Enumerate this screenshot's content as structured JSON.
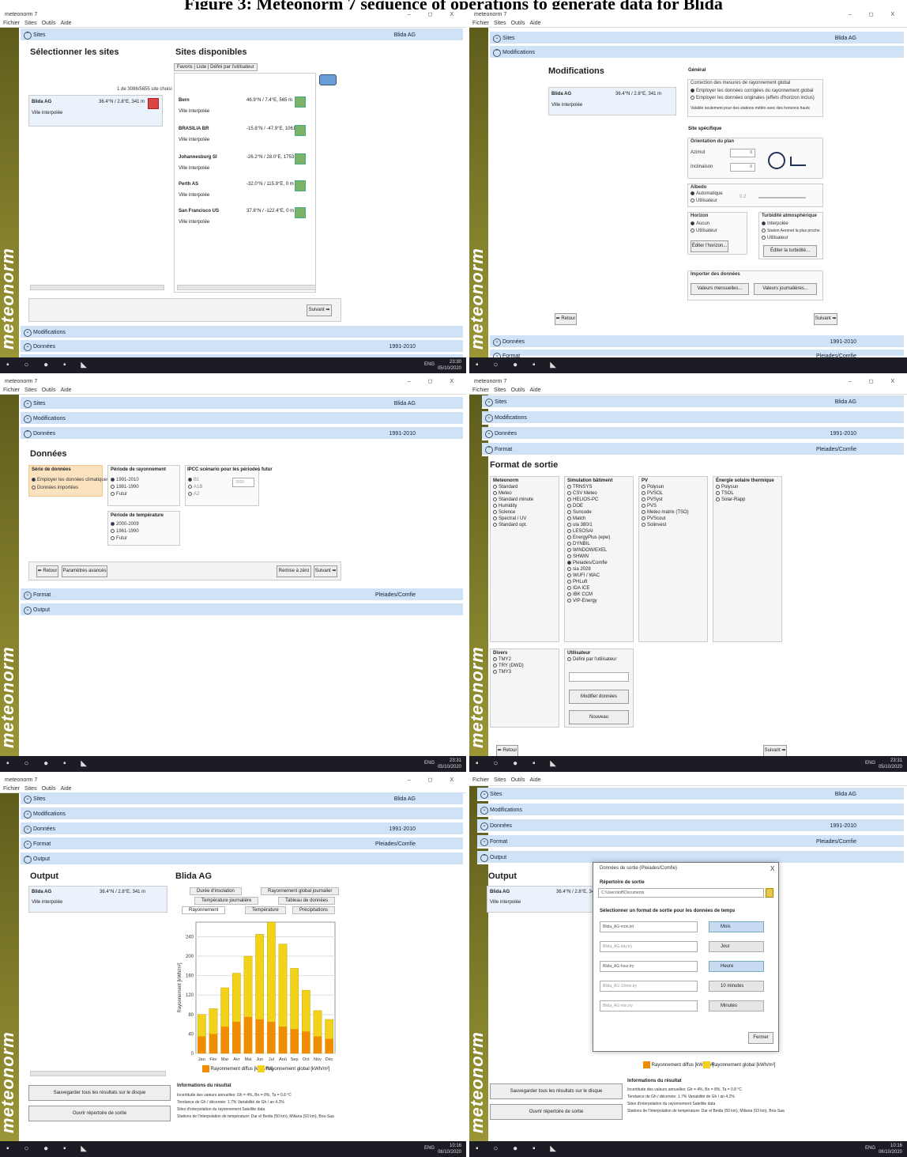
{
  "heading": "Figure 3: Meteonorm 7 sequence of operations to generate data for Blida",
  "app": {
    "title": "meteonorm 7",
    "menu": [
      "Fichier",
      "Sites",
      "Outils",
      "Aide"
    ],
    "brand": "meteonorm",
    "window_controls": "–  ◻  X"
  },
  "sections": {
    "sites": "Sites",
    "modifications": "Modifications",
    "donnees": "Données",
    "format": "Format",
    "output": "Output",
    "site_value": "Blida AG",
    "period_value": "1991-2010",
    "format_value": "Pleiades/Comfie"
  },
  "taskbar": {
    "clock1": "23:30",
    "date1": "05/10/2020",
    "clock2": "23:31",
    "date2": "05/10/2020",
    "clock3": "10:16",
    "date3": "06/10/2020",
    "lang": "ENG"
  },
  "p1": {
    "title_left": "Sélectionner les sites",
    "title_right": "Sites disponibles",
    "tabs": [
      "Favoris",
      "Liste",
      "Défini par l'utilisateur"
    ],
    "count": "1 de 3086/5655 site choisi",
    "selected_site": "Blida AG",
    "selected_coords": "36.4°N / 2.8°E, 341 m",
    "selected_sub": "Ville interpolée",
    "sites": [
      {
        "name": "Bern",
        "coords": "46.9°N / 7.4°E, 565 m",
        "sub": "Ville interpolée"
      },
      {
        "name": "BRASILIA BR",
        "coords": "-15.8°N / -47.9°E, 1061 m",
        "sub": "Ville interpolée"
      },
      {
        "name": "Johannesburg SI",
        "coords": "-26.2°N / 28.0°E, 1753 m",
        "sub": "Ville interpolée"
      },
      {
        "name": "Perth AS",
        "coords": "-32.0°N / 115.9°E, 0 m",
        "sub": "Ville interpolée"
      },
      {
        "name": "San Francisco US",
        "coords": "37.8°N / -122.4°E, 0 m",
        "sub": "Ville interpolée"
      }
    ],
    "next": "Suivant ➡"
  },
  "p2": {
    "title": "Modifications",
    "site": "Blida AG",
    "coords": "36.4°N / 2.8°E, 341 m",
    "sub": "Ville interpolée",
    "general": "Général",
    "corr_title": "Correction des mesures de rayonnement global",
    "corr1": "Employer les données corrigées du rayonnement global",
    "corr2": "Employer les données originales (effets d'horizon inclus)",
    "corr_note": "Valable seulement pour des stations météo avec des horizons hauts",
    "specific": "Site spécifique",
    "orientation": "Orientation du plan",
    "azimut": "Azimut",
    "azimut_val": "0",
    "inclinaison": "Inclinaison",
    "incl_val": "0",
    "albedo": "Albedo",
    "albedo_auto": "Automatique",
    "albedo_user": "Utilisateur",
    "albedo_val": "0.2",
    "horizon": "Horizon",
    "hz_aucun": "Aucun",
    "hz_user": "Utilisateur",
    "hz_btn": "Éditer l'horizon...",
    "turb": "Turbidité atmosphérique",
    "turb1": "Interpolée",
    "turb2": "Station Aeronet la plus proche",
    "turb3": "Utilisateur",
    "turb_btn": "Éditer la turbidité...",
    "import": "Importer des données",
    "imp1": "Valeurs mensuelles...",
    "imp2": "Valeurs journalières...",
    "back": "⬅ Retour",
    "next": "Suivant ➡"
  },
  "p3": {
    "title": "Données",
    "serie": "Série de données",
    "serie1": "Employer les données climatiques",
    "serie2": "Données importées",
    "ray": "Période de rayonnement",
    "ray1": "1991-2010",
    "ray2": "1981-1990",
    "ray3": "Futur",
    "ipcc": "IPCC scénario pour les périodes futur",
    "b1": "B1",
    "a1b": "A1B",
    "a2": "A2",
    "year": "2020",
    "temp": "Période de température",
    "t1": "2000-2009",
    "t2": "1961-1990",
    "t3": "Futur",
    "back": "⬅ Retour",
    "adv": "Paramètres avancés",
    "reset": "Remise à zéro",
    "next": "Suivant ➡"
  },
  "p4": {
    "title": "Format de sortie",
    "cols": [
      {
        "h": "Meteonorm",
        "items": [
          "Standard",
          "Meteo",
          "Standard minute",
          "Humidity",
          "Science",
          "Spectral / UV",
          "Standard opt."
        ]
      },
      {
        "h": "Simulation bâtiment",
        "items": [
          "TRNSYS",
          "CSV Meteo",
          "HELIOS-PC",
          "DOE",
          "Suncode",
          "Match",
          "ula 380/1",
          "LESOSAI",
          "EnergyPlus (epw)",
          "DYNBIL",
          "WINDOW/EXEL",
          "SHWIN",
          "Pleiades/Comfie",
          "sia 2028",
          "WUFI / WAC",
          "PHLuft",
          "IDA ICE",
          "IBK CCM",
          "VIP-Energy"
        ]
      },
      {
        "h": "PV",
        "items": [
          "Polysun",
          "PVSOL",
          "PVSyst",
          "PVS",
          "Meteo matrix (TSO)",
          "PVScout",
          "Solinvest"
        ]
      },
      {
        "h": "Énergie solaire thermique",
        "items": [
          "Polysun",
          "TSOL",
          "Solar-Rapp"
        ]
      }
    ],
    "divers": "Divers",
    "divers_items": [
      "TMY2",
      "TRY (DWD)",
      "TMY3"
    ],
    "user": "Utilisateur",
    "user_item": "Défini par l'utilisateur",
    "modify": "Modifier données",
    "new": "Nouveau",
    "back": "⬅ Retour",
    "next": "Suivant ➡"
  },
  "p5": {
    "title": "Output",
    "site": "Blida AG",
    "coords": "36.4°N / 2.8°E, 341 m",
    "sub": "Ville interpolée",
    "chart_title": "Blida AG",
    "tabs_row1": [
      "Durée d'insolation",
      "Rayonnement global journalier"
    ],
    "tabs_row2": [
      "Température journalière",
      "Tableau de données"
    ],
    "tabs_row3": [
      "Rayonnement",
      "Température",
      "Précipitations"
    ],
    "ylabel": "Rayonnement [kWh/m²]",
    "legend_diffuse": "Rayonnement diffus [kWh/m²]",
    "legend_global": "Rayonnement global [kWh/m²]",
    "save_btn": "Sauvegarder tous les résultats sur le disque",
    "open_btn": "Ouvrir répertoire de sortie",
    "info_title": "Informations du résultat",
    "info": [
      "Incertitude des valeurs annuelles: Gh = 4%, Bn = 8%, Ta = 0.8 °C",
      "Tendance de Gh / décennie: 1.7%   Variabilité de Gh / an 4.2%",
      "Sites d'interpolation du rayonnement Satellite data",
      "Stations de l'interpolation de température: Dar el Beida (50 km), Miliana (93 km), Bou-Saa"
    ]
  },
  "p6": {
    "dialog_title": "Données de sortie (Pleiades/Comfie)",
    "dir_label": "Répertoire de sortie",
    "dir_value": "C:\\Users\\toff\\Documents",
    "select_label": "Sélectionner un format de sortie pour les données de temps",
    "files": [
      "Blida_AG-mon.txt",
      "Blida_AG-day.try",
      "Blida_AG-hour.try",
      "Blida_AG-10min.try",
      "Blida_AG-min.try"
    ],
    "opts": [
      "Mois",
      "Jour",
      "Heure",
      "10 minutes",
      "Minutes"
    ],
    "close": "Fermer"
  },
  "chart_data": {
    "type": "bar",
    "title": "Blida AG",
    "xlabel": "",
    "ylabel": "Rayonnement [kWh/m²]",
    "ylim": [
      0,
      270
    ],
    "yticks": [
      0,
      40,
      80,
      120,
      160,
      200,
      240
    ],
    "categories": [
      "Jan",
      "Fév",
      "Mar",
      "Avr",
      "Mai",
      "Jun",
      "Jul",
      "Aoû",
      "Sep",
      "Oct",
      "Nov",
      "Déc"
    ],
    "series": [
      {
        "name": "Rayonnement diffus [kWh/m²]",
        "values": [
          35,
          40,
          55,
          65,
          75,
          70,
          65,
          55,
          50,
          45,
          35,
          30
        ]
      },
      {
        "name": "Rayonnement global [kWh/m²]",
        "values": [
          80,
          92,
          135,
          165,
          200,
          245,
          270,
          225,
          175,
          130,
          88,
          70
        ]
      }
    ],
    "colors": [
      "#f08c00",
      "#f3d21a"
    ],
    "grid": true,
    "legend": "bottom"
  }
}
